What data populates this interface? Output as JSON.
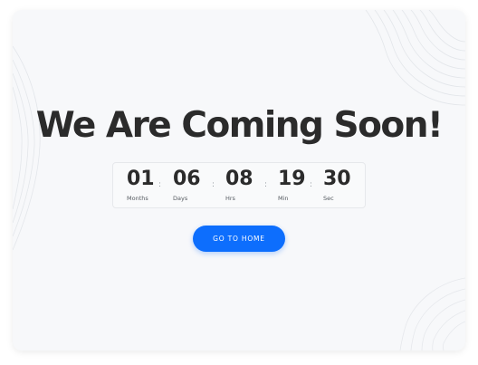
{
  "main": {
    "title": "We Are Coming Soon!"
  },
  "countdown": {
    "units": [
      {
        "value": "01",
        "label": "Months"
      },
      {
        "value": "06",
        "label": "Days"
      },
      {
        "value": "08",
        "label": "Hrs"
      },
      {
        "value": "19",
        "label": "Min"
      },
      {
        "value": "30",
        "label": "Sec"
      }
    ],
    "separator": ":"
  },
  "button": {
    "label": "GO TO HOME"
  },
  "colors": {
    "accent": "#0d6efd",
    "title_text": "#2b2b2b",
    "card_bg": "#f7f8fa"
  }
}
